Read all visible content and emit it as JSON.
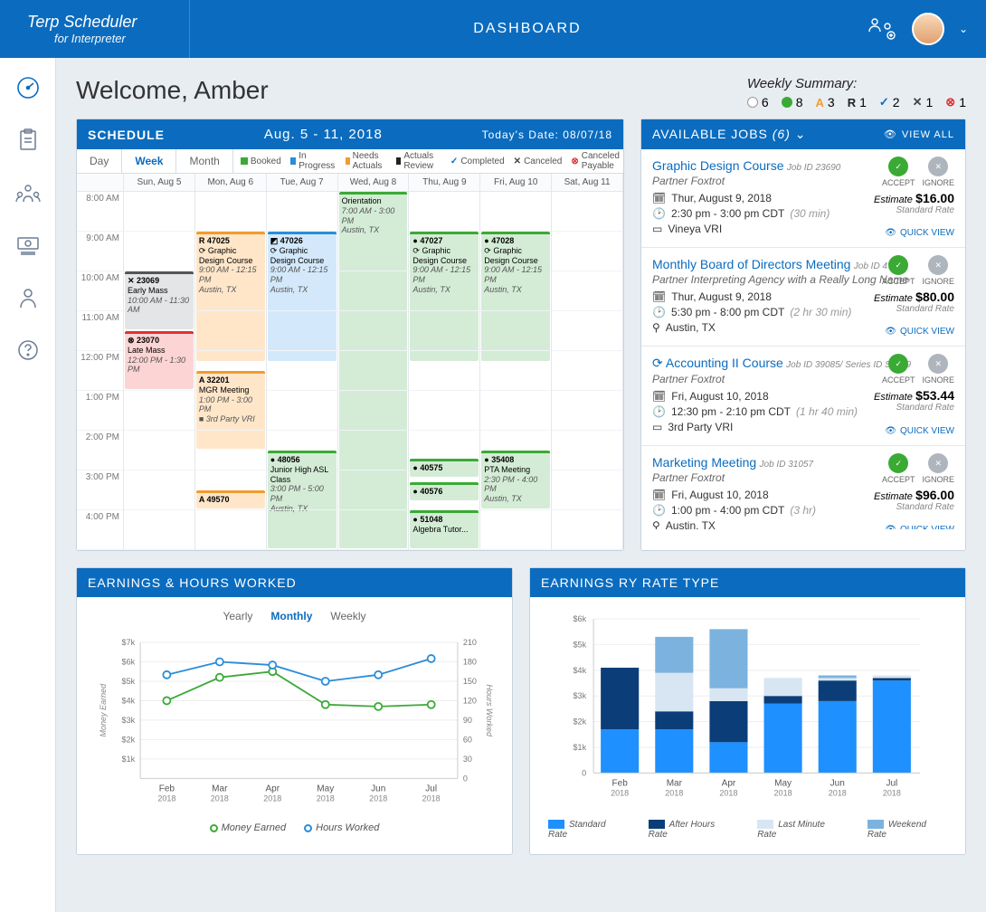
{
  "header": {
    "brand_line1": "Terp Scheduler",
    "brand_line2": "for Interpreter",
    "title": "DASHBOARD"
  },
  "welcome": "Welcome, Amber",
  "summary": {
    "title": "Weekly Summary:",
    "items": [
      {
        "label": "6",
        "color": "#fff",
        "border": "#999"
      },
      {
        "label": "8",
        "color": "#3aaa35"
      },
      {
        "label": "3",
        "color": "#f29b2e",
        "glyph": "A"
      },
      {
        "label": "1",
        "color": "#222",
        "glyph": "R"
      },
      {
        "label": "2",
        "color": "#0b6cbf",
        "glyph": "✓",
        "hollow": true
      },
      {
        "label": "1",
        "color": "#444",
        "glyph": "✕",
        "hollow": true
      },
      {
        "label": "1",
        "color": "#d33",
        "glyph": "⊗",
        "hollow": true
      }
    ]
  },
  "schedule": {
    "title": "SCHEDULE",
    "range": "Aug. 5 - 11, 2018",
    "today": "Today's Date: 08/07/18",
    "views": [
      "Day",
      "Week",
      "Month"
    ],
    "active_view": "Week",
    "legend": [
      {
        "label": "Booked",
        "color": "#3aaa35"
      },
      {
        "label": "In Progress",
        "color": "#2a8dd8"
      },
      {
        "label": "Needs Actuals",
        "color": "#f29b2e"
      },
      {
        "label": "Actuals Review",
        "color": "#222"
      },
      {
        "label": "Completed",
        "color": "#0b6cbf",
        "glyph": "✓"
      },
      {
        "label": "Canceled",
        "color": "#444",
        "glyph": "✕"
      },
      {
        "label": "Canceled Payable",
        "color": "#d33",
        "glyph": "⊗"
      }
    ],
    "days": [
      "Sun, Aug 5",
      "Mon, Aug 6",
      "Tue, Aug 7",
      "Wed, Aug 8",
      "Thu, Aug 9",
      "Fri, Aug 10",
      "Sat, Aug 11"
    ],
    "hours": [
      "8:00 AM",
      "9:00 AM",
      "10:00 AM",
      "11:00 AM",
      "12:00 PM",
      "1:00 PM",
      "2:00 PM",
      "3:00 PM",
      "4:00 PM"
    ],
    "events": [
      {
        "day": 3,
        "start": 0,
        "span": 9,
        "cls": "green",
        "lines": [
          "Orientation",
          "7:00 AM - 3:00 PM",
          "Austin, TX"
        ]
      },
      {
        "day": 1,
        "start": 1,
        "span": 3.3,
        "cls": "orange",
        "id": "47025",
        "glyph": "R",
        "lines": [
          "⟳ Graphic Design Course",
          "9:00 AM - 12:15 PM",
          "Austin, TX"
        ]
      },
      {
        "day": 2,
        "start": 1,
        "span": 3.3,
        "cls": "blue",
        "id": "47026",
        "glyph": "◩",
        "lines": [
          "⟳ Graphic Design Course",
          "9:00 AM - 12:15 PM",
          "Austin, TX"
        ]
      },
      {
        "day": 4,
        "start": 1,
        "span": 3.3,
        "cls": "green",
        "id": "47027",
        "glyph": "●",
        "lines": [
          "⟳ Graphic Design Course",
          "9:00 AM - 12:15 PM",
          "Austin, TX"
        ]
      },
      {
        "day": 5,
        "start": 1,
        "span": 3.3,
        "cls": "green",
        "id": "47028",
        "glyph": "●",
        "lines": [
          "⟳ Graphic Design Course",
          "9:00 AM - 12:15 PM",
          "Austin, TX"
        ]
      },
      {
        "day": 0,
        "start": 2,
        "span": 1.5,
        "cls": "gray",
        "id": "23069",
        "glyph": "✕",
        "lines": [
          "Early Mass",
          "10:00 AM - 11:30 AM"
        ]
      },
      {
        "day": 0,
        "start": 3.5,
        "span": 1.5,
        "cls": "red",
        "id": "23070",
        "glyph": "⊗",
        "lines": [
          "Late Mass",
          "12:00 PM - 1:30 PM"
        ]
      },
      {
        "day": 1,
        "start": 4.5,
        "span": 2,
        "cls": "orange",
        "id": "32201",
        "glyph": "A",
        "lines": [
          "MGR Meeting",
          "1:00 PM - 3:00 PM",
          "■ 3rd Party VRI"
        ]
      },
      {
        "day": 1,
        "start": 7.5,
        "span": 0.5,
        "cls": "orange",
        "id": "49570",
        "glyph": "A",
        "lines": []
      },
      {
        "day": 2,
        "start": 6.5,
        "span": 2.5,
        "cls": "green",
        "id": "48056",
        "glyph": "●",
        "lines": [
          "Junior High ASL Class",
          "3:00 PM - 5:00 PM",
          "Austin, TX"
        ]
      },
      {
        "day": 4,
        "start": 6.7,
        "span": 0.5,
        "cls": "green",
        "id": "40575",
        "glyph": "●",
        "lines": []
      },
      {
        "day": 4,
        "start": 7.3,
        "span": 0.5,
        "cls": "green",
        "id": "40576",
        "glyph": "●",
        "lines": []
      },
      {
        "day": 4,
        "start": 8,
        "span": 1,
        "cls": "green",
        "id": "51048",
        "glyph": "●",
        "lines": [
          "Algebra Tutor..."
        ]
      },
      {
        "day": 5,
        "start": 6.5,
        "span": 1.5,
        "cls": "green",
        "id": "35408",
        "glyph": "●",
        "lines": [
          "PTA Meeting",
          "2:30 PM - 4:00 PM",
          "Austin, TX"
        ]
      }
    ]
  },
  "jobs": {
    "title": "AVAILABLE JOBS",
    "count": "(6)",
    "viewall": "VIEW ALL",
    "accept": "ACCEPT",
    "ignore": "IGNORE",
    "quickview": "QUICK VIEW",
    "estimate": "Estimate",
    "items": [
      {
        "title": "Graphic Design Course",
        "id": "Job ID 23690",
        "partner": "Partner Foxtrot",
        "date": "Thur, August 9, 2018",
        "time": "2:30 pm - 3:00 pm CDT",
        "dur": "(30 min)",
        "loc": "Vineya VRI",
        "loc_icon": "video",
        "amount": "$16.00",
        "rate": "Standard Rate"
      },
      {
        "title": "Monthly Board of Directors Meeting",
        "id": "Job ID 47053",
        "partner": "Partner Interpreting Agency with a Really Long Name",
        "date": "Thur, August 9, 2018",
        "time": "5:30 pm - 8:00 pm CDT",
        "dur": "(2 hr 30 min)",
        "loc": "Austin, TX",
        "loc_icon": "pin",
        "amount": "$80.00",
        "rate": "Standard Rate"
      },
      {
        "title": "Accounting II Course",
        "id": "Job ID 39085/ Series ID S1599",
        "partner": "Partner Foxtrot",
        "date": "Fri, August 10, 2018",
        "time": "12:30 pm - 2:10 pm CDT",
        "dur": "(1 hr 40 min)",
        "loc": "3rd Party VRI",
        "loc_icon": "video",
        "amount": "$53.44",
        "rate": "Standard Rate",
        "recurring": true
      },
      {
        "title": "Marketing Meeting",
        "id": "Job ID 31057",
        "partner": "Partner Foxtrot",
        "date": "Fri, August 10, 2018",
        "time": "1:00 pm - 4:00 pm CDT",
        "dur": "(3 hr)",
        "loc": "Austin, TX",
        "loc_icon": "pin",
        "amount": "$96.00",
        "rate": "Standard Rate"
      }
    ]
  },
  "chart_data": [
    {
      "panel_title": "EARNINGS & HOURS WORKED",
      "type": "line",
      "tabs": [
        "Yearly",
        "Monthly",
        "Weekly"
      ],
      "active_tab": "Monthly",
      "categories": [
        "Feb 2018",
        "Mar 2018",
        "Apr 2018",
        "May 2018",
        "Jun 2018",
        "Jul 2018"
      ],
      "series": [
        {
          "name": "Money Earned",
          "color": "#3aaa35",
          "values": [
            4000,
            5200,
            5500,
            3800,
            3700,
            3800
          ],
          "axis": "left"
        },
        {
          "name": "Hours Worked",
          "color": "#2a8dd8",
          "values": [
            160,
            180,
            175,
            150,
            160,
            185
          ],
          "axis": "right"
        }
      ],
      "ylabel_left": "Money Earned",
      "ylabel_right": "Hours Worked",
      "yticks_left": [
        "$1k",
        "$2k",
        "$3k",
        "$4k",
        "$5k",
        "$6k",
        "$7k"
      ],
      "yticks_right": [
        "0",
        "30",
        "60",
        "90",
        "120",
        "150",
        "180",
        "210"
      ],
      "ylim_left": [
        0,
        7000
      ],
      "ylim_right": [
        0,
        210
      ]
    },
    {
      "panel_title": "EARNINGS RY RATE TYPE",
      "type": "bar",
      "stacked": true,
      "categories": [
        "Feb 2018",
        "Mar 2018",
        "Apr 2018",
        "May 2018",
        "Jun 2018",
        "Jul 2018"
      ],
      "series": [
        {
          "name": "Standard Rate",
          "color": "#1e90ff",
          "values": [
            1700,
            1700,
            1200,
            2700,
            2800,
            3600
          ]
        },
        {
          "name": "After Hours Rate",
          "color": "#0b3e78",
          "values": [
            2400,
            700,
            1600,
            300,
            800,
            100
          ]
        },
        {
          "name": "Last Minute Rate",
          "color": "#d7e6f2",
          "values": [
            0,
            1500,
            500,
            700,
            100,
            100
          ]
        },
        {
          "name": "Weekend Rate",
          "color": "#7bb3de",
          "values": [
            0,
            1400,
            2300,
            0,
            100,
            0
          ]
        }
      ],
      "ylabel": "",
      "yticks": [
        "0",
        "$1k",
        "$2k",
        "$3k",
        "$4k",
        "$5k",
        "$6k"
      ],
      "ylim": [
        0,
        6000
      ]
    }
  ]
}
